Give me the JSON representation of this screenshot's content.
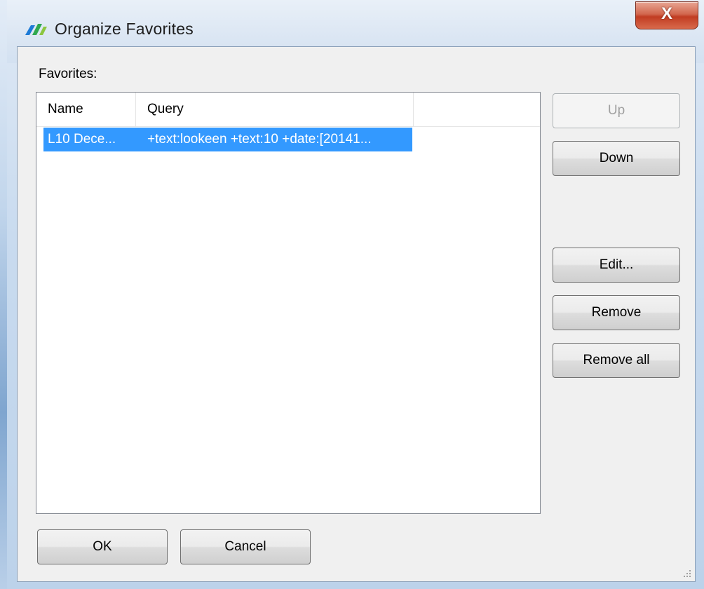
{
  "window": {
    "title": "Organize Favorites",
    "close_glyph": "X"
  },
  "favorites": {
    "label": "Favorites:",
    "columns": [
      "Name",
      "Query"
    ],
    "rows": [
      {
        "name": "L10 Dece...",
        "query": "+text:lookeen +text:10 +date:[20141...",
        "selected": true
      }
    ]
  },
  "buttons": {
    "up": "Up",
    "down": "Down",
    "edit": "Edit...",
    "remove": "Remove",
    "remove_all": "Remove all",
    "ok": "OK",
    "cancel": "Cancel"
  },
  "colors": {
    "selection": "#3399ff",
    "close_button": "#c13c22"
  },
  "icons": {
    "app": "favorites-app-icon",
    "close": "close-icon",
    "resize": "resize-grip-icon"
  }
}
